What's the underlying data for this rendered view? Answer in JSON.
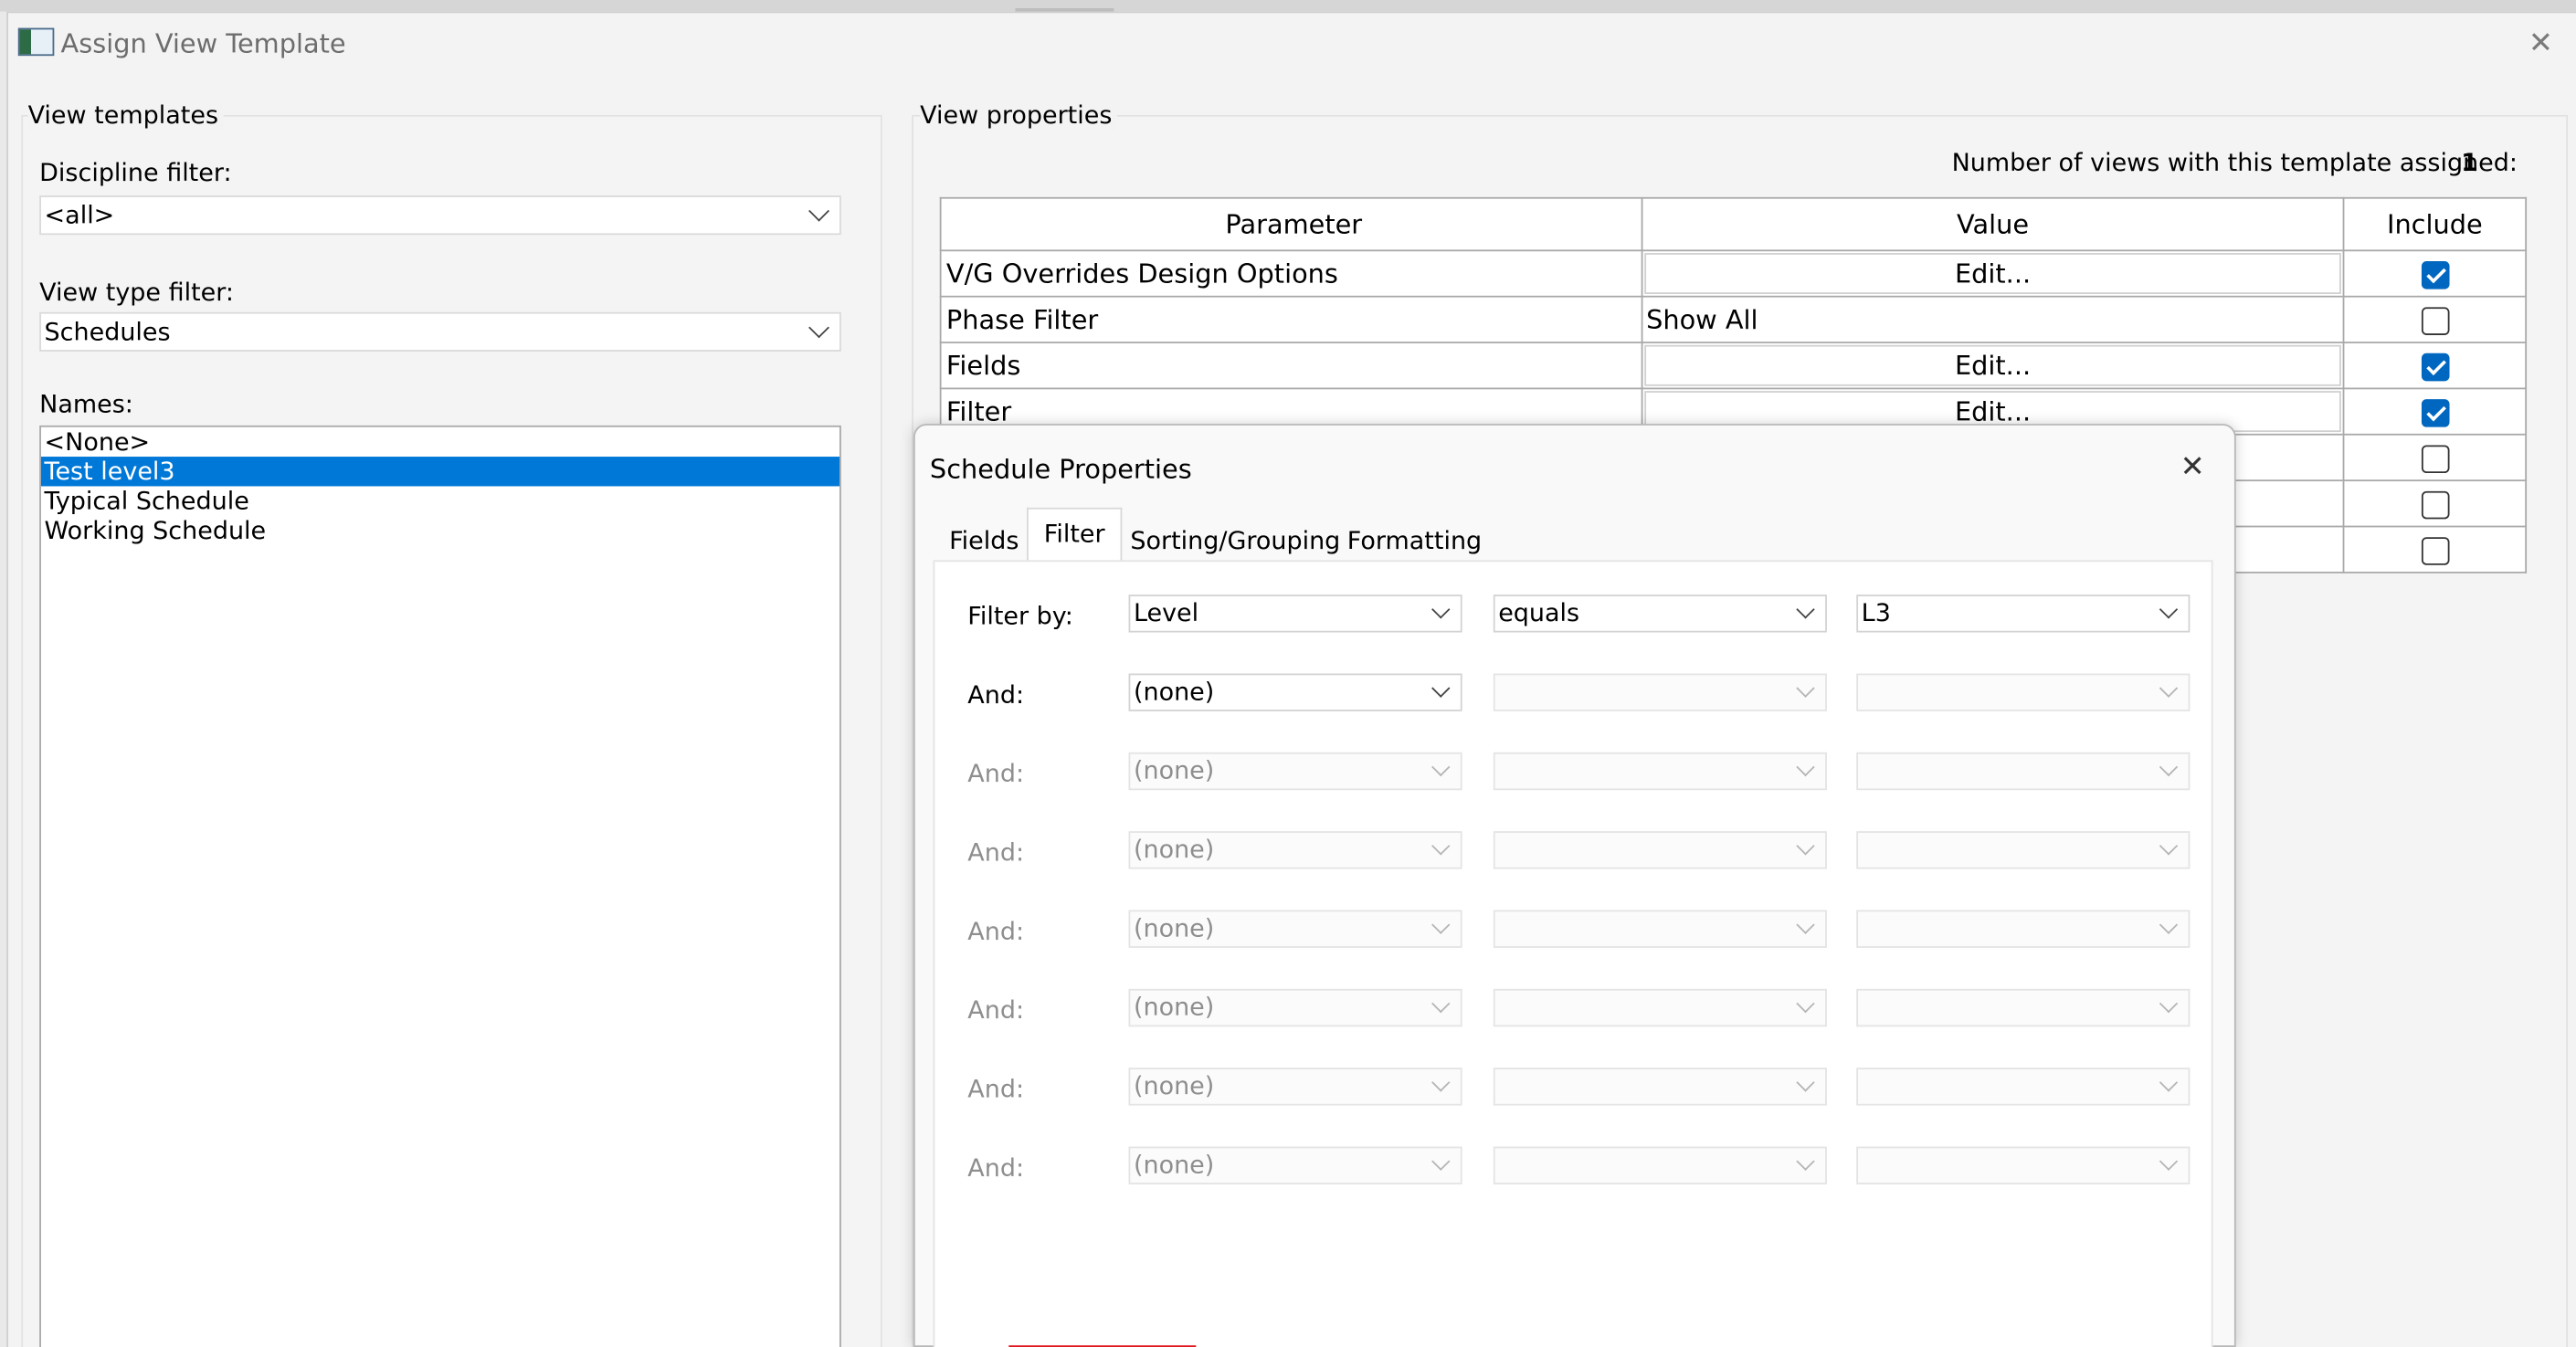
{
  "window": {
    "title": "Assign View Template",
    "close": "✕"
  },
  "left": {
    "group_title": "View templates",
    "discipline_label": "Discipline filter:",
    "discipline_value": "<all>",
    "view_type_label": "View type filter:",
    "view_type_value": "Schedules",
    "names_label": "Names:",
    "names": [
      {
        "label": "<None>",
        "selected": false
      },
      {
        "label": "Test level3",
        "selected": true
      },
      {
        "label": "Typical Schedule",
        "selected": false
      },
      {
        "label": "Working Schedule",
        "selected": false
      }
    ]
  },
  "right": {
    "group_title": "View properties",
    "count_label": "Number of views with this template assigned:",
    "count_value": "1",
    "columns": {
      "parameter": "Parameter",
      "value": "Value",
      "include": "Include"
    },
    "rows": [
      {
        "parameter": "V/G Overrides Design Options",
        "value": "Edit...",
        "value_is_button": true,
        "include": true
      },
      {
        "parameter": "Phase Filter",
        "value": "Show All",
        "value_is_button": false,
        "include": false
      },
      {
        "parameter": "Fields",
        "value": "Edit...",
        "value_is_button": true,
        "include": true
      },
      {
        "parameter": "Filter",
        "value": "Edit...",
        "value_is_button": true,
        "include": true
      },
      {
        "parameter": "",
        "value": "",
        "value_is_button": false,
        "include": false
      },
      {
        "parameter": "",
        "value": "",
        "value_is_button": false,
        "include": false
      },
      {
        "parameter": "",
        "value": "",
        "value_is_button": false,
        "include": false
      }
    ]
  },
  "dialog": {
    "title": "Schedule Properties",
    "close": "✕",
    "tabs": [
      "Fields",
      "Filter",
      "Sorting/Grouping",
      "Formatting"
    ],
    "active_tab": "Filter",
    "filter_rows": [
      {
        "label": "Filter by:",
        "field": "Level",
        "condition": "equals",
        "value": "L3",
        "enabled": true,
        "label_enabled": true
      },
      {
        "label": "And:",
        "field": "(none)",
        "condition": "",
        "value": "",
        "enabled": false,
        "label_enabled": true,
        "field_enabled": true
      },
      {
        "label": "And:",
        "field": "(none)",
        "condition": "",
        "value": "",
        "enabled": false,
        "label_enabled": false
      },
      {
        "label": "And:",
        "field": "(none)",
        "condition": "",
        "value": "",
        "enabled": false,
        "label_enabled": false
      },
      {
        "label": "And:",
        "field": "(none)",
        "condition": "",
        "value": "",
        "enabled": false,
        "label_enabled": false
      },
      {
        "label": "And:",
        "field": "(none)",
        "condition": "",
        "value": "",
        "enabled": false,
        "label_enabled": false
      },
      {
        "label": "And:",
        "field": "(none)",
        "condition": "",
        "value": "",
        "enabled": false,
        "label_enabled": false
      },
      {
        "label": "And:",
        "field": "(none)",
        "condition": "",
        "value": "",
        "enabled": false,
        "label_enabled": false
      }
    ]
  },
  "colors": {
    "selection": "#0078d7",
    "checkbox": "#0067c0",
    "highlight": "#e01b22"
  }
}
